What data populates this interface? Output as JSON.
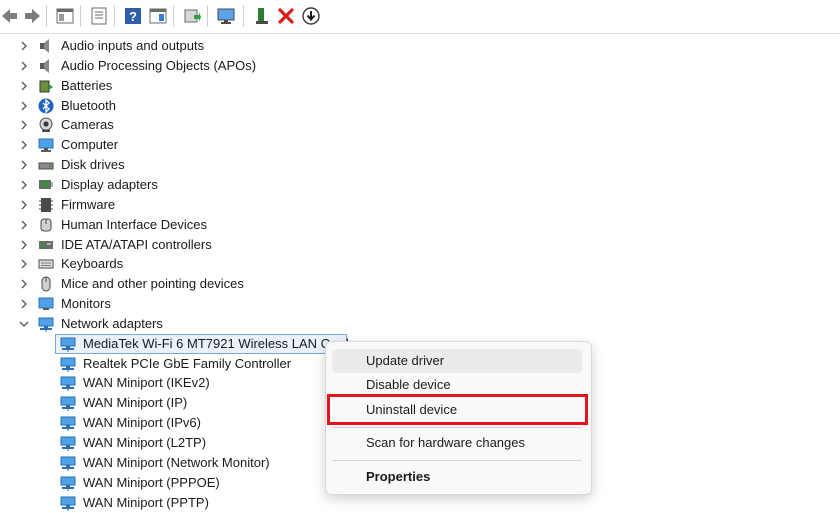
{
  "toolbar": {
    "buttons": [
      {
        "name": "back-button",
        "icon": "arrow-left-icon"
      },
      {
        "name": "forward-button",
        "icon": "arrow-right-icon"
      },
      {
        "name": "show-hide-console-tree-button",
        "icon": "console-tree-icon"
      },
      {
        "name": "properties-button",
        "icon": "properties-sheet-icon"
      },
      {
        "name": "help-button",
        "icon": "help-icon"
      },
      {
        "name": "action-pane-button",
        "icon": "action-pane-icon"
      },
      {
        "name": "update-driver-button",
        "icon": "update-driver-icon"
      },
      {
        "name": "scan-hardware-button",
        "icon": "monitor-scan-icon"
      },
      {
        "name": "enable-device-button",
        "icon": "enable-device-icon"
      },
      {
        "name": "uninstall-device-button",
        "icon": "red-x-icon"
      },
      {
        "name": "disable-device-button",
        "icon": "down-arrow-circle-icon"
      }
    ]
  },
  "tree": {
    "categories": [
      {
        "label": "Audio inputs and outputs",
        "icon": "speaker-icon",
        "expanded": false
      },
      {
        "label": "Audio Processing Objects (APOs)",
        "icon": "speaker-icon",
        "expanded": false
      },
      {
        "label": "Batteries",
        "icon": "battery-icon",
        "expanded": false
      },
      {
        "label": "Bluetooth",
        "icon": "bluetooth-icon",
        "expanded": false
      },
      {
        "label": "Cameras",
        "icon": "camera-icon",
        "expanded": false
      },
      {
        "label": "Computer",
        "icon": "computer-icon",
        "expanded": false
      },
      {
        "label": "Disk drives",
        "icon": "disk-drive-icon",
        "expanded": false
      },
      {
        "label": "Display adapters",
        "icon": "display-adapter-icon",
        "expanded": false
      },
      {
        "label": "Firmware",
        "icon": "firmware-icon",
        "expanded": false
      },
      {
        "label": "Human Interface Devices",
        "icon": "hid-icon",
        "expanded": false
      },
      {
        "label": "IDE ATA/ATAPI controllers",
        "icon": "ide-controller-icon",
        "expanded": false
      },
      {
        "label": "Keyboards",
        "icon": "keyboard-icon",
        "expanded": false
      },
      {
        "label": "Mice and other pointing devices",
        "icon": "mouse-icon",
        "expanded": false
      },
      {
        "label": "Monitors",
        "icon": "monitor-icon",
        "expanded": false
      },
      {
        "label": "Network adapters",
        "icon": "network-adapter-icon",
        "expanded": true
      }
    ],
    "network_children": [
      {
        "label": "MediaTek Wi-Fi 6 MT7921 Wireless LAN Card",
        "selected": true
      },
      {
        "label": "Realtek PCIe GbE Family Controller",
        "selected": false
      },
      {
        "label": "WAN Miniport (IKEv2)",
        "selected": false
      },
      {
        "label": "WAN Miniport (IP)",
        "selected": false
      },
      {
        "label": "WAN Miniport (IPv6)",
        "selected": false
      },
      {
        "label": "WAN Miniport (L2TP)",
        "selected": false
      },
      {
        "label": "WAN Miniport (Network Monitor)",
        "selected": false
      },
      {
        "label": "WAN Miniport (PPPOE)",
        "selected": false
      },
      {
        "label": "WAN Miniport (PPTP)",
        "selected": false
      }
    ]
  },
  "context_menu": {
    "items": [
      {
        "label": "Update driver",
        "state": "hover"
      },
      {
        "label": "Disable device",
        "state": "normal"
      },
      {
        "label": "Uninstall device",
        "state": "highlighted"
      },
      {
        "label": "Scan for hardware changes",
        "state": "normal"
      },
      {
        "label": "Properties",
        "state": "bold"
      }
    ]
  },
  "colors": {
    "highlight_border": "#e3141b",
    "selection_border": "#7aa7e0",
    "selection_fill": "#eaf2fc",
    "network_icon": "#2f8fd6"
  }
}
